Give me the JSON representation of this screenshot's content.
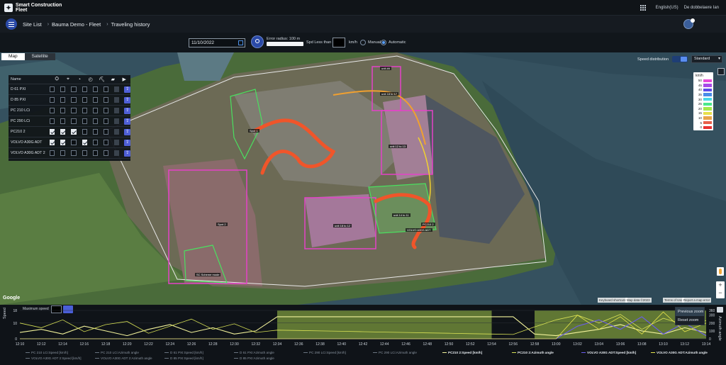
{
  "app": {
    "brand": "Smart Construction Fleet",
    "language": "English(US)",
    "user_name": "De dobbelaere Ian"
  },
  "breadcrumb": [
    "Site List",
    "Bauma Demo - Fleet",
    "Traveling history"
  ],
  "filters": {
    "date": "11/10/2022",
    "error_radius_label": "Error radius: 100 m",
    "speed_less_than_label": "Spd Less than",
    "speed_unit": "km/h",
    "mode_manual": "Manual",
    "mode_automatic": "Automatic",
    "selected_mode": "Automatic"
  },
  "map": {
    "tabs": [
      "Map",
      "Satellite"
    ],
    "active_tab": "Map",
    "speed_distribution_label": "Speed distribution",
    "view_select": "Standard",
    "vehicle_panel_name_header": "Name",
    "vehicle_header_icons": [
      "machine-icon",
      "location-icon",
      "gauge-icon",
      "speedometer-icon",
      "excavator-icon",
      "truck-icon",
      "video-icon",
      "export-icon"
    ],
    "vehicles": [
      {
        "name": "D 61 PXI",
        "checks": [
          false,
          false,
          false,
          false,
          false,
          false,
          false
        ]
      },
      {
        "name": "D 85 PXI",
        "checks": [
          false,
          false,
          false,
          false,
          false,
          false,
          false
        ]
      },
      {
        "name": "PC 210 LCi",
        "checks": [
          false,
          false,
          false,
          false,
          false,
          false,
          false
        ]
      },
      {
        "name": "PC 290 LCi",
        "checks": [
          false,
          false,
          false,
          false,
          false,
          false,
          false
        ]
      },
      {
        "name": "PC210 2",
        "checks": [
          true,
          true,
          true,
          false,
          false,
          false,
          false
        ]
      },
      {
        "name": "VOLVO A30G ADT",
        "checks": [
          true,
          true,
          false,
          true,
          false,
          false,
          false
        ]
      },
      {
        "name": "VOLVO A30G ADT 2",
        "checks": [
          false,
          false,
          false,
          false,
          false,
          false,
          false
        ]
      }
    ],
    "speed_legend": {
      "unit": "km/h",
      "values": [
        "50",
        "45",
        "40",
        "35",
        "30",
        "25",
        "20",
        "15",
        "10",
        "5",
        "0"
      ],
      "colors": [
        "#e84ad9",
        "#a84ae8",
        "#5c4ae8",
        "#4a8ce8",
        "#4ad6e8",
        "#4ae88c",
        "#a4e84a",
        "#e8e04a",
        "#e8a44a",
        "#e8604a",
        "#e83030"
      ]
    },
    "labels": [
      "Spot 1",
      "Spot 2",
      "unit 18 to 17",
      "unit 12 to 13",
      "unit 14 to 11",
      "unit 18 to 12",
      "PC210 2",
      "VOLVO A30G ADT",
      "SC Scheme mode",
      "unit ##"
    ],
    "google_logo": "Google",
    "footer": [
      "Keyboard shortcuts",
      "Map data ©2023",
      "Terms of Use",
      "Report a map error"
    ]
  },
  "chart_panel": {
    "max_speed_label": "Maximum speed",
    "zoom_menu": [
      "Previous zoom",
      "Reset zoom"
    ],
    "y_title": "Speed",
    "y2_title": "Azimuth angle"
  },
  "chart_data": {
    "type": "line",
    "xlabel": "",
    "ylabel": "Speed",
    "y2label": "Azimuth angle",
    "x": [
      "12:10",
      "12:12",
      "12:14",
      "12:16",
      "12:18",
      "12:20",
      "12:22",
      "12:24",
      "12:26",
      "12:28",
      "12:30",
      "12:32",
      "12:34",
      "12:36",
      "12:38",
      "12:40",
      "12:42",
      "12:44",
      "12:46",
      "12:48",
      "12:50",
      "12:52",
      "12:54",
      "12:56",
      "12:58",
      "13:00",
      "13:02",
      "13:04",
      "13:06",
      "13:08",
      "13:10",
      "13:12",
      "13:14"
    ],
    "ylim": [
      0,
      18
    ],
    "y_ticks": [
      "0",
      "10",
      "18"
    ],
    "y2lim": [
      0,
      360
    ],
    "y2_ticks": [
      "0",
      "100",
      "200",
      "300",
      "360"
    ],
    "highlight_ranges": [
      [
        "12:34",
        "12:54"
      ],
      [
        "12:58",
        "13:14"
      ]
    ],
    "series": [
      {
        "name": "PC 210 LCi:Speed [km/h]",
        "style": "dashed-gray"
      },
      {
        "name": "PC 210 LCi:Azimuth angle",
        "style": "dashed-gray"
      },
      {
        "name": "D 61 PXI:Speed [km/h]",
        "style": "dashed-gray"
      },
      {
        "name": "D 61 PXI:Azimuth angle",
        "style": "dashed-gray"
      },
      {
        "name": "PC 290 LCi:Speed [km/h]",
        "style": "dashed-gray"
      },
      {
        "name": "PC 290 LCi:Azimuth angle",
        "style": "dashed-gray"
      },
      {
        "name": "PC210 2:Speed [km/h]",
        "color": "#f1f19a",
        "values": [
          4,
          6,
          3,
          8,
          5,
          2,
          6,
          9,
          4,
          7,
          3,
          5,
          14,
          14,
          14,
          14,
          14,
          14,
          14,
          14,
          14,
          14,
          14,
          14,
          3,
          2,
          4,
          6,
          9,
          5,
          3,
          7,
          4
        ]
      },
      {
        "name": "PC210 2:Azimuth angle",
        "color": "#d7e055",
        "values": [
          200,
          140,
          240,
          90,
          180,
          220,
          70,
          160,
          250,
          120,
          190,
          80,
          110,
          105,
          100,
          95,
          90,
          85,
          80,
          75,
          70,
          65,
          60,
          55,
          150,
          240,
          300,
          200,
          310,
          120,
          260,
          180,
          230
        ]
      },
      {
        "name": "VOLVO A30G ADT:Speed [km/h]",
        "color": "#6a5cf0",
        "values": [
          0,
          0,
          0,
          0,
          0,
          0,
          0,
          0,
          0,
          0,
          0,
          0,
          0,
          0,
          0,
          0,
          0,
          0,
          0,
          0,
          0,
          0,
          0,
          0,
          0,
          0,
          8,
          12,
          6,
          14,
          3,
          10,
          2
        ]
      },
      {
        "name": "VOLVO A30G ADT:Azimuth angle",
        "color": "#e6e44a",
        "values": [
          0,
          0,
          0,
          0,
          0,
          0,
          0,
          0,
          0,
          0,
          0,
          0,
          0,
          0,
          0,
          0,
          0,
          0,
          0,
          0,
          0,
          0,
          0,
          0,
          0,
          0,
          300,
          120,
          280,
          60,
          340,
          90,
          200
        ]
      },
      {
        "name": "VOLVO A30G ADT 2:Speed [km/h]",
        "style": "dashed-gray"
      },
      {
        "name": "VOLVO A30G ADT 2:Azimuth angle",
        "style": "dashed-gray"
      },
      {
        "name": "D 85 PXI:Speed [km/h]",
        "style": "dashed-gray"
      },
      {
        "name": "D 85 PXI:Azimuth angle",
        "style": "dashed-gray"
      }
    ],
    "legend": "bottom"
  }
}
